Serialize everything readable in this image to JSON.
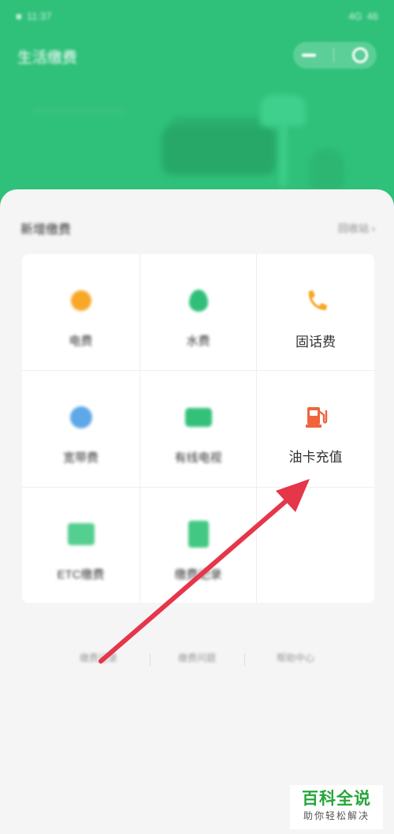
{
  "status_bar": {
    "time": "11:37",
    "signal": "4G",
    "battery": "46"
  },
  "header": {
    "title": "生活缴费"
  },
  "section": {
    "title": "新增缴费",
    "more_label": "回收站"
  },
  "services": [
    {
      "label": "电费",
      "icon": "lightning-icon",
      "color": "#f7a828"
    },
    {
      "label": "水费",
      "icon": "water-drop-icon",
      "color": "#2fbf78"
    },
    {
      "label": "固话费",
      "icon": "phone-icon",
      "color": "#f7a828"
    },
    {
      "label": "宽带费",
      "icon": "globe-icon",
      "color": "#5fa8e8"
    },
    {
      "label": "有线电视",
      "icon": "tv-icon",
      "color": "#33c17a"
    },
    {
      "label": "油卡充值",
      "icon": "gas-station-icon",
      "color": "#f0643c"
    },
    {
      "label": "ETC缴费",
      "icon": "etc-card-icon",
      "color": "#55cf90"
    },
    {
      "label": "缴费记录",
      "icon": "bill-icon",
      "color": "#42c882"
    }
  ],
  "bottom_links": [
    "缴费记录",
    "缴费问题",
    "帮助中心"
  ],
  "watermark": {
    "title": "百科全说",
    "subtitle": "助你轻松解决"
  },
  "colors": {
    "brand_green": "#2fc17a",
    "arrow_red": "#e5364a"
  }
}
